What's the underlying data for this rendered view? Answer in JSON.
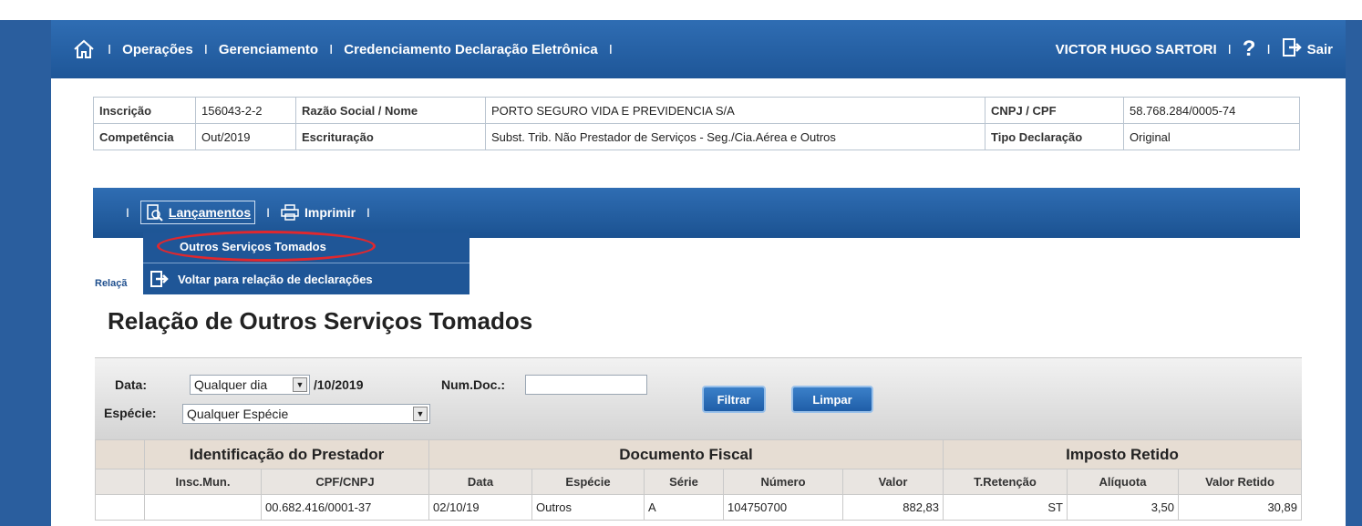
{
  "topbar": {
    "links": [
      "Operações",
      "Gerenciamento",
      "Credenciamento Declaração Eletrônica"
    ],
    "user": "VICTOR HUGO SARTORI",
    "logout": "Sair"
  },
  "info": {
    "inscricao_label": "Inscrição",
    "inscricao": "156043-2-2",
    "razao_label": "Razão Social / Nome",
    "razao": "PORTO SEGURO VIDA E PREVIDENCIA S/A",
    "cnpj_label": "CNPJ / CPF",
    "cnpj": "58.768.284/0005-74",
    "competencia_label": "Competência",
    "competencia": "Out/2019",
    "escrituracao_label": "Escrituração",
    "escrituracao": "Subst. Trib. Não Prestador de Serviços - Seg./Cia.Aérea e Outros",
    "tipo_label": "Tipo Declaração",
    "tipo": "Original"
  },
  "menubar": {
    "lancamentos": "Lançamentos",
    "imprimir": "Imprimir"
  },
  "dropdown": {
    "option1": "Outros Serviços Tomados",
    "option2": "Voltar para relação de declarações"
  },
  "breadcrumb": "Relaçã",
  "page_title": "Relação de Outros Serviços Tomados",
  "filter": {
    "data_label": "Data:",
    "data_value": "Qualquer dia",
    "data_suffix": "/10/2019",
    "numdoc_label": "Num.Doc.:",
    "numdoc_value": "",
    "especie_label": "Espécie:",
    "especie_value": "Qualquer Espécie",
    "filtrar": "Filtrar",
    "limpar": "Limpar"
  },
  "grid": {
    "groups": [
      "Identificação do Prestador",
      "Documento Fiscal",
      "Imposto Retido"
    ],
    "columns": [
      "Insc.Mun.",
      "CPF/CNPJ",
      "Data",
      "Espécie",
      "Série",
      "Número",
      "Valor",
      "T.Retenção",
      "Alíquota",
      "Valor Retido"
    ],
    "rows": [
      [
        "",
        "00.682.416/0001-37",
        "02/10/19",
        "Outros",
        "A",
        "104750700",
        "882,83",
        "ST",
        "3,50",
        "30,89"
      ]
    ]
  }
}
